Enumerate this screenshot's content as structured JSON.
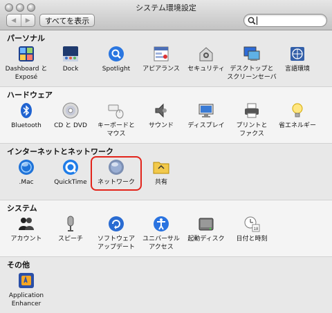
{
  "window": {
    "title": "システム環境設定",
    "back_label": "◀",
    "forward_label": "▶",
    "show_all_label": "すべてを表示",
    "search_value": "",
    "search_placeholder": ""
  },
  "sections": [
    {
      "title": "パーソナル",
      "items": [
        {
          "label": "Dashboard と\nExposé",
          "icon": "dashboard-icon"
        },
        {
          "label": "Dock",
          "icon": "dock-icon"
        },
        {
          "label": "Spotlight",
          "icon": "spotlight-icon"
        },
        {
          "label": "アピアランス",
          "icon": "appearance-icon"
        },
        {
          "label": "セキュリティ",
          "icon": "security-icon"
        },
        {
          "label": "デスクトップと\nスクリーンセーバ",
          "icon": "desktop-icon"
        },
        {
          "label": "言語環境",
          "icon": "international-icon"
        }
      ]
    },
    {
      "title": "ハードウェア",
      "items": [
        {
          "label": "Bluetooth",
          "icon": "bluetooth-icon"
        },
        {
          "label": "CD と DVD",
          "icon": "cd-dvd-icon"
        },
        {
          "label": "キーボードと\nマウス",
          "icon": "keyboard-mouse-icon"
        },
        {
          "label": "サウンド",
          "icon": "sound-icon"
        },
        {
          "label": "ディスプレイ",
          "icon": "display-icon"
        },
        {
          "label": "プリントと\nファクス",
          "icon": "printer-icon"
        },
        {
          "label": "省エネルギー",
          "icon": "energy-saver-icon"
        }
      ]
    },
    {
      "title": "インターネットとネットワーク",
      "items": [
        {
          "label": ".Mac",
          "icon": "dotmac-icon"
        },
        {
          "label": "QuickTime",
          "icon": "quicktime-icon"
        },
        {
          "label": "ネットワーク",
          "icon": "network-icon",
          "highlighted": true
        },
        {
          "label": "共有",
          "icon": "sharing-icon"
        }
      ]
    },
    {
      "title": "システム",
      "items": [
        {
          "label": "アカウント",
          "icon": "accounts-icon"
        },
        {
          "label": "スピーチ",
          "icon": "speech-icon"
        },
        {
          "label": "ソフトウェア\nアップデート",
          "icon": "software-update-icon"
        },
        {
          "label": "ユニバーサル\nアクセス",
          "icon": "universal-access-icon"
        },
        {
          "label": "起動ディスク",
          "icon": "startup-disk-icon"
        },
        {
          "label": "日付と時刻",
          "icon": "date-time-icon"
        }
      ]
    },
    {
      "title": "その他",
      "items": [
        {
          "label": "Application\nEnhancer",
          "icon": "application-enhancer-icon"
        }
      ]
    }
  ],
  "colors": {
    "highlight": "#e2231a",
    "alt_band": "#e8e8e8"
  }
}
